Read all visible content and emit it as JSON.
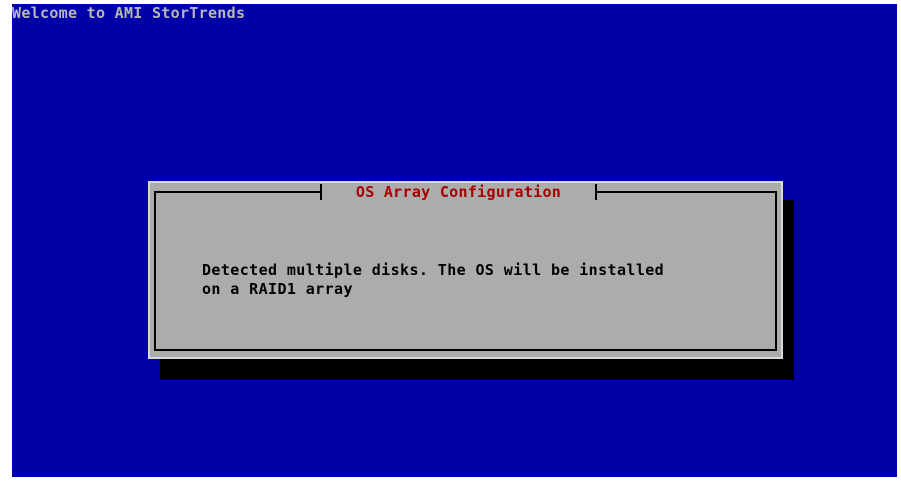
{
  "screen": {
    "welcome_text": "Welcome to AMI StorTrends",
    "background_color": "#0000a8"
  },
  "dialog": {
    "title": "OS Array Configuration",
    "message_lines": [
      "Detected multiple disks. The OS will be installed",
      "on a RAID1 array"
    ],
    "title_color": "#a80000",
    "body_color": "#acacac"
  }
}
